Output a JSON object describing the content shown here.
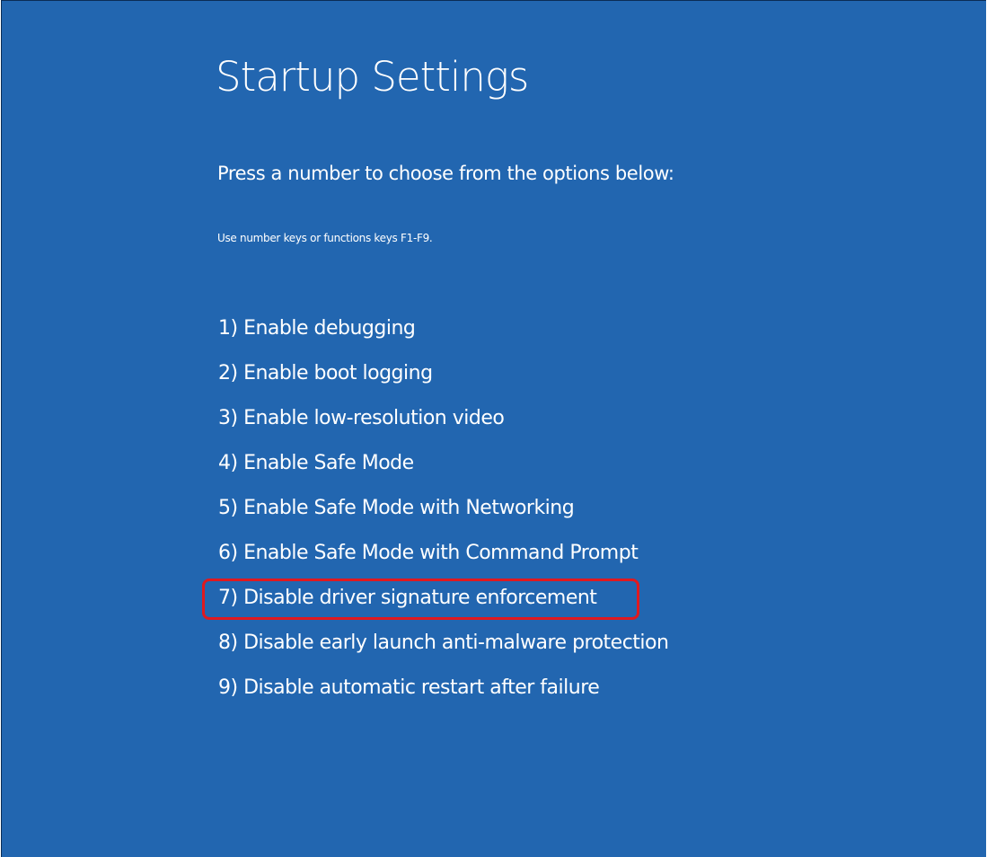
{
  "title": "Startup Settings",
  "instruction": "Press a number to choose from the options below:",
  "hint": "Use number keys or functions keys F1-F9.",
  "options": [
    {
      "label": "1) Enable debugging"
    },
    {
      "label": "2) Enable boot logging"
    },
    {
      "label": "3) Enable low-resolution video"
    },
    {
      "label": "4) Enable Safe Mode"
    },
    {
      "label": "5) Enable Safe Mode with Networking"
    },
    {
      "label": "6) Enable Safe Mode with Command Prompt"
    },
    {
      "label": "7) Disable driver signature enforcement",
      "highlighted": true
    },
    {
      "label": "8) Disable early launch anti-malware protection"
    },
    {
      "label": "9) Disable automatic restart after failure"
    }
  ],
  "colors": {
    "background": "#2266b0",
    "text": "#ffffff",
    "highlight_border": "#e0191f"
  }
}
